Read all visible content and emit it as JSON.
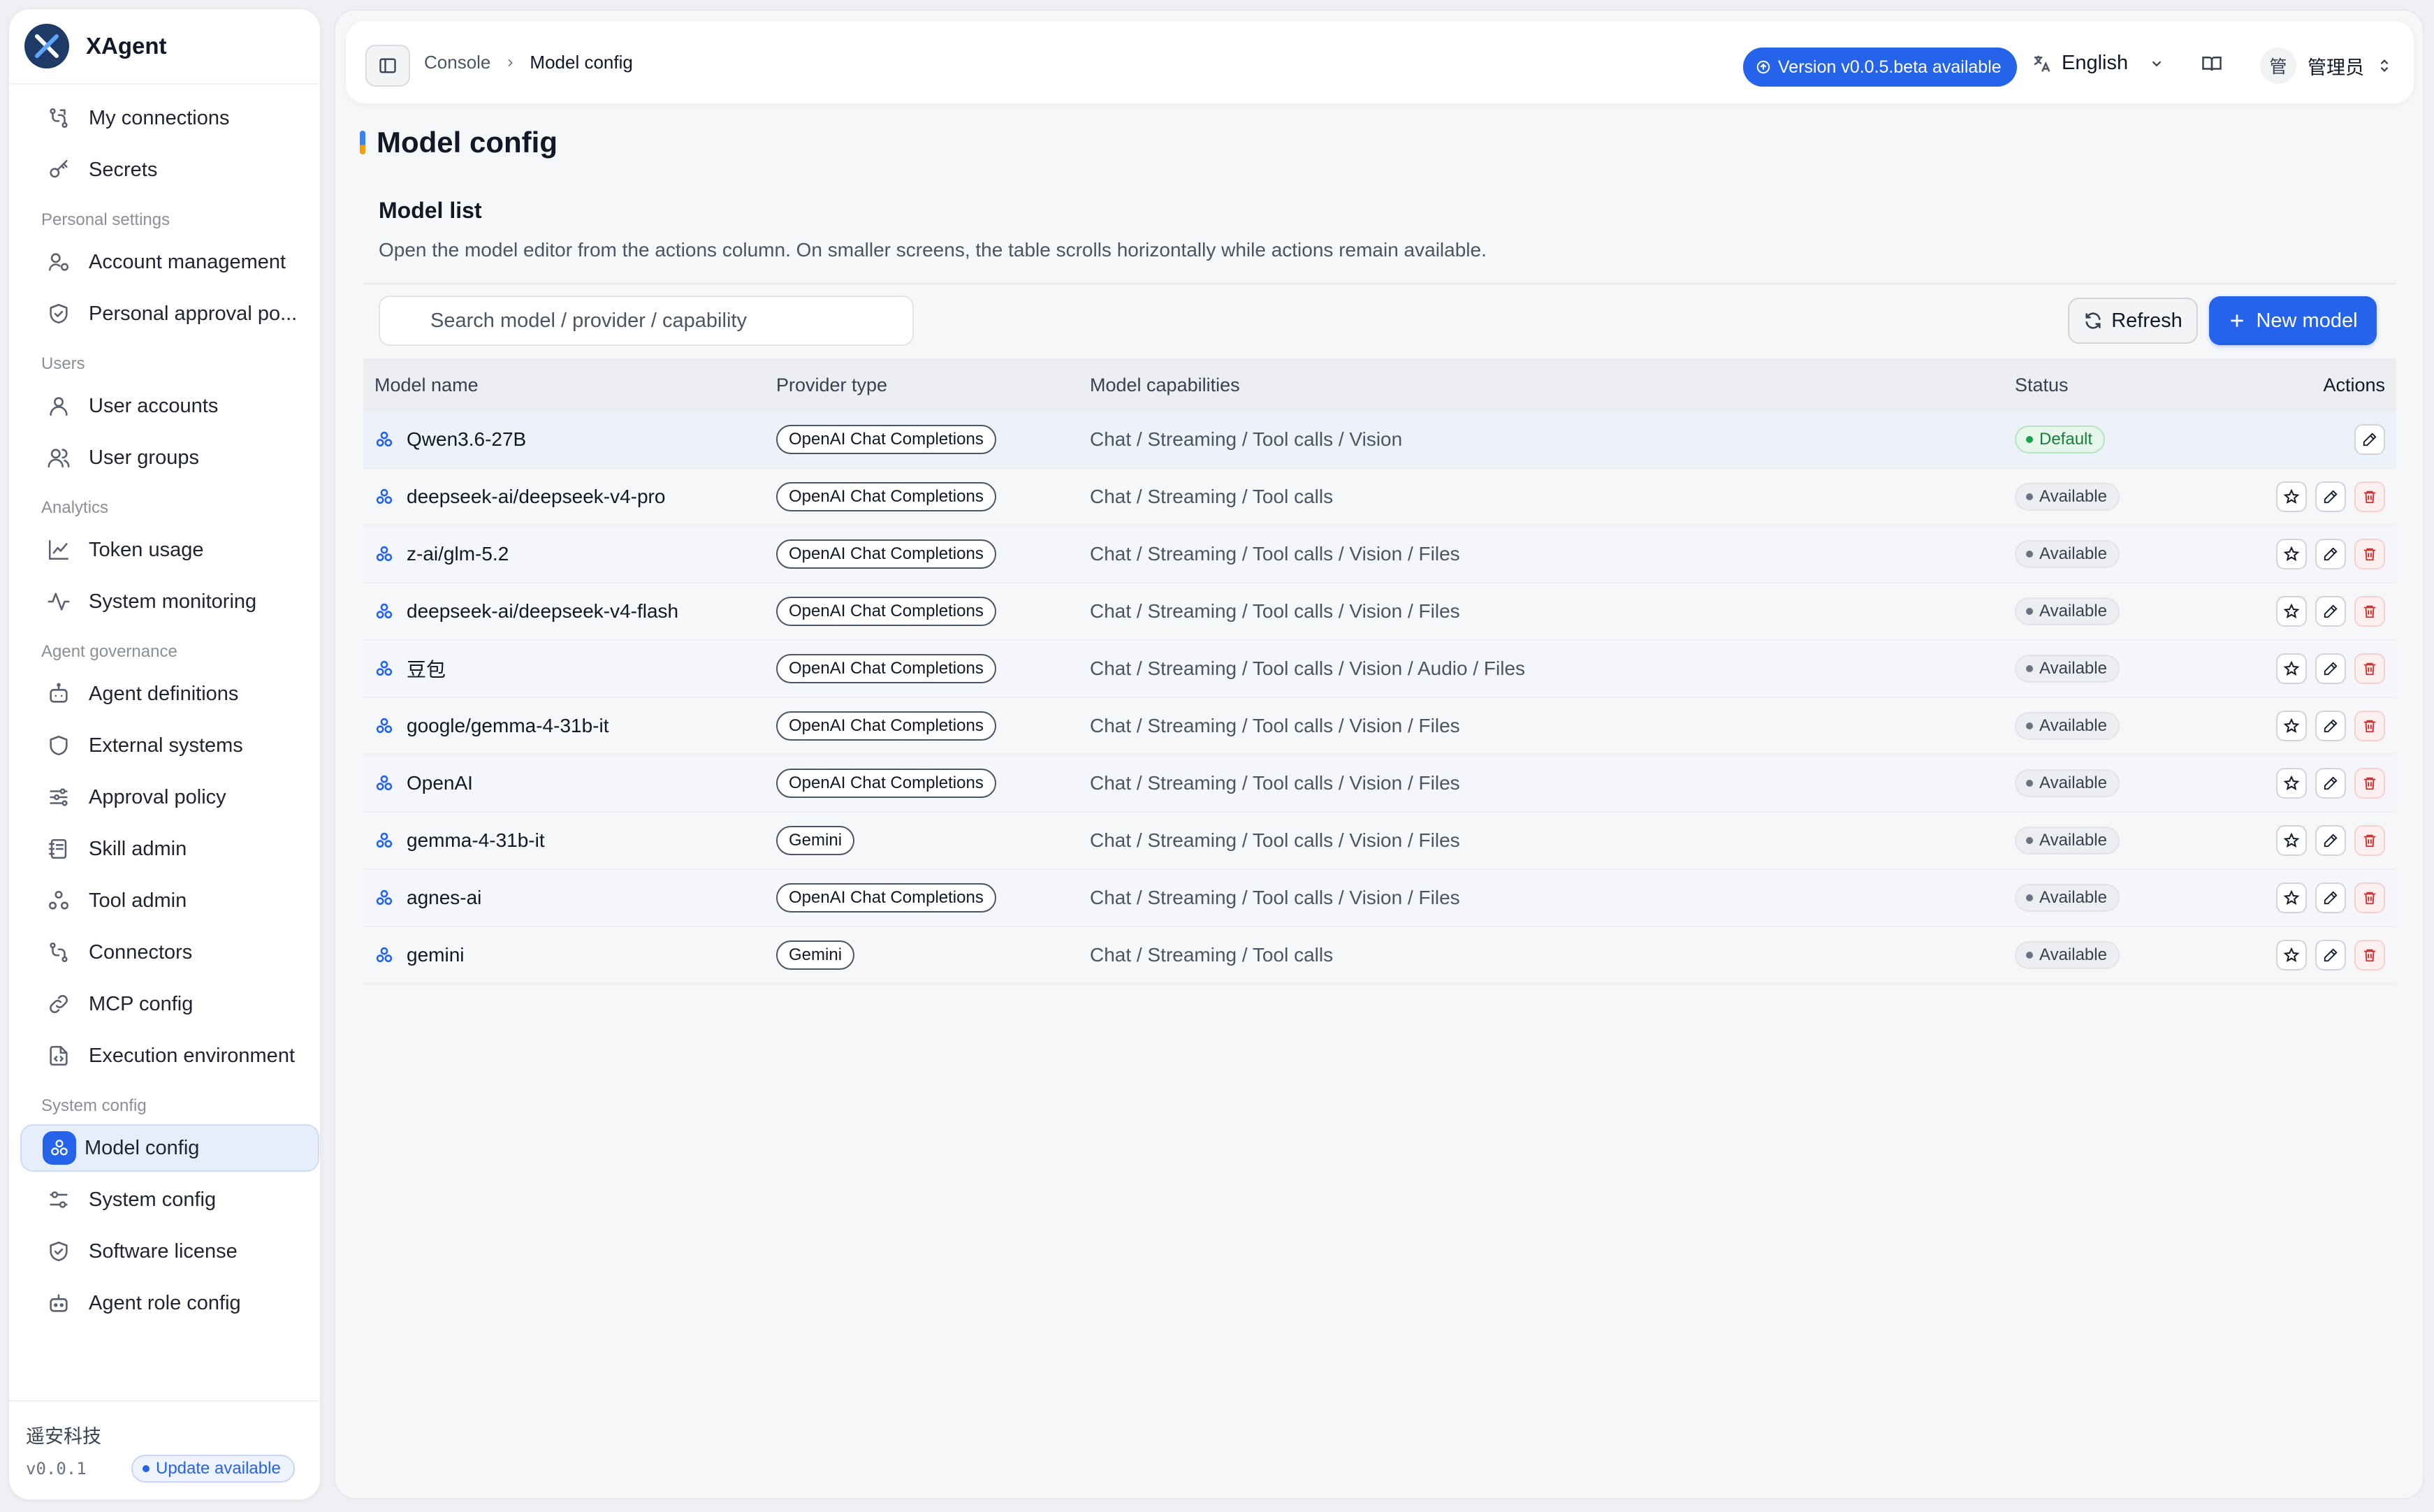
{
  "app": {
    "name": "XAgent"
  },
  "sidebar": {
    "top_items": [
      {
        "label": "My connections",
        "icon": "connections-icon"
      },
      {
        "label": "Secrets",
        "icon": "key-icon"
      }
    ],
    "sections": [
      {
        "title": "Personal settings",
        "items": [
          {
            "label": "Account management",
            "icon": "user-settings-icon"
          },
          {
            "label": "Personal approval po...",
            "icon": "shield-check-icon"
          }
        ]
      },
      {
        "title": "Users",
        "items": [
          {
            "label": "User accounts",
            "icon": "user-icon"
          },
          {
            "label": "User groups",
            "icon": "users-icon"
          }
        ]
      },
      {
        "title": "Analytics",
        "items": [
          {
            "label": "Token usage",
            "icon": "line-chart-icon"
          },
          {
            "label": "System monitoring",
            "icon": "activity-icon"
          }
        ]
      },
      {
        "title": "Agent governance",
        "items": [
          {
            "label": "Agent definitions",
            "icon": "bot-icon"
          },
          {
            "label": "External systems",
            "icon": "shield-icon"
          },
          {
            "label": "Approval policy",
            "icon": "sliders-icon"
          },
          {
            "label": "Skill admin",
            "icon": "notebook-icon"
          },
          {
            "label": "Tool admin",
            "icon": "tools-icon"
          },
          {
            "label": "Connectors",
            "icon": "plug-icon"
          },
          {
            "label": "MCP config",
            "icon": "link-icon"
          },
          {
            "label": "Execution environment",
            "icon": "file-code-icon"
          }
        ]
      },
      {
        "title": "System config",
        "items": [
          {
            "label": "Model config",
            "icon": "model-icon",
            "active": true
          },
          {
            "label": "System config",
            "icon": "settings-sliders-icon"
          },
          {
            "label": "Software license",
            "icon": "license-shield-icon"
          },
          {
            "label": "Agent role config",
            "icon": "robot-icon"
          }
        ]
      }
    ],
    "footer": {
      "company": "遥安科技",
      "version": "v0.0.1",
      "update_badge": "Update available"
    }
  },
  "topbar": {
    "breadcrumb": [
      "Console",
      "Model config"
    ],
    "version_badge": "Version v0.0.5.beta available",
    "language": "English",
    "user_avatar": "管",
    "user_name": "管理员"
  },
  "page": {
    "title": "Model config",
    "list_title": "Model list",
    "list_description": "Open the model editor from the actions column. On smaller screens, the table scrolls horizontally while actions remain available.",
    "search_placeholder": "Search model / provider / capability",
    "refresh_label": "Refresh",
    "new_model_label": "New model"
  },
  "table": {
    "columns": [
      "Model name",
      "Provider type",
      "Model capabilities",
      "Status",
      "Actions"
    ],
    "rows": [
      {
        "name": "Qwen3.6-27B",
        "provider": "OpenAI Chat Completions",
        "capabilities": "Chat / Streaming / Tool calls / Vision",
        "status": "Default",
        "status_kind": "default"
      },
      {
        "name": "deepseek-ai/deepseek-v4-pro",
        "provider": "OpenAI Chat Completions",
        "capabilities": "Chat / Streaming / Tool calls",
        "status": "Available",
        "status_kind": "available"
      },
      {
        "name": "z-ai/glm-5.2",
        "provider": "OpenAI Chat Completions",
        "capabilities": "Chat / Streaming / Tool calls / Vision / Files",
        "status": "Available",
        "status_kind": "available"
      },
      {
        "name": "deepseek-ai/deepseek-v4-flash",
        "provider": "OpenAI Chat Completions",
        "capabilities": "Chat / Streaming / Tool calls / Vision / Files",
        "status": "Available",
        "status_kind": "available"
      },
      {
        "name": "豆包",
        "provider": "OpenAI Chat Completions",
        "capabilities": "Chat / Streaming / Tool calls / Vision / Audio / Files",
        "status": "Available",
        "status_kind": "available"
      },
      {
        "name": "google/gemma-4-31b-it",
        "provider": "OpenAI Chat Completions",
        "capabilities": "Chat / Streaming / Tool calls / Vision / Files",
        "status": "Available",
        "status_kind": "available"
      },
      {
        "name": "OpenAI",
        "provider": "OpenAI Chat Completions",
        "capabilities": "Chat / Streaming / Tool calls / Vision / Files",
        "status": "Available",
        "status_kind": "available"
      },
      {
        "name": "gemma-4-31b-it",
        "provider": "Gemini",
        "capabilities": "Chat / Streaming / Tool calls / Vision / Files",
        "status": "Available",
        "status_kind": "available"
      },
      {
        "name": "agnes-ai",
        "provider": "OpenAI Chat Completions",
        "capabilities": "Chat / Streaming / Tool calls / Vision / Files",
        "status": "Available",
        "status_kind": "available"
      },
      {
        "name": "gemini",
        "provider": "Gemini",
        "capabilities": "Chat / Streaming / Tool calls",
        "status": "Available",
        "status_kind": "available"
      }
    ]
  },
  "colors": {
    "accent": "#2563eb",
    "default_status": "#16a34a",
    "delete": "#dc2626"
  }
}
